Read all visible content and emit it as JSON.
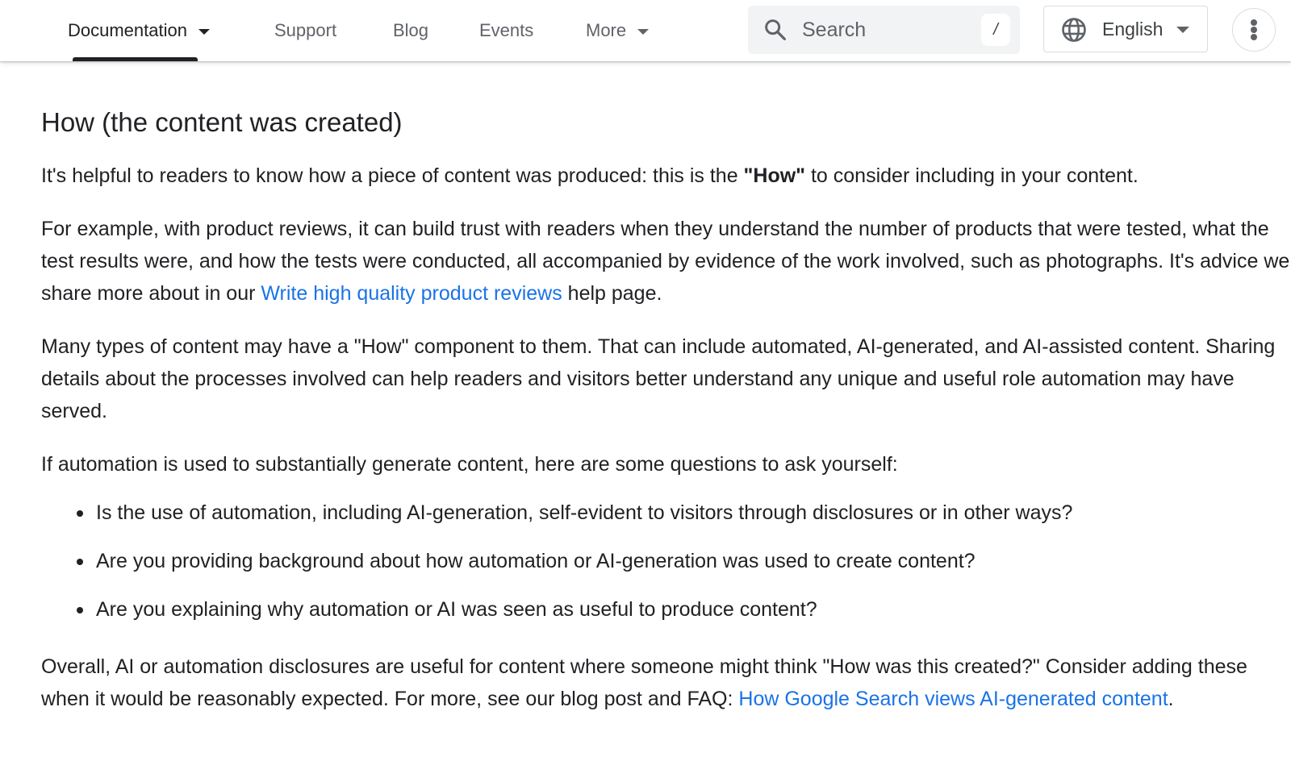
{
  "header": {
    "nav": [
      {
        "label": "Documentation",
        "has_dropdown": true,
        "active": true
      },
      {
        "label": "Support",
        "has_dropdown": false,
        "active": false
      },
      {
        "label": "Blog",
        "has_dropdown": false,
        "active": false
      },
      {
        "label": "Events",
        "has_dropdown": false,
        "active": false
      },
      {
        "label": "More",
        "has_dropdown": true,
        "active": false
      }
    ],
    "search": {
      "placeholder": "Search",
      "shortcut_key": "/",
      "icon": "search-icon"
    },
    "language": {
      "selected": "English",
      "icon": "globe-icon"
    },
    "overflow_menu_icon": "more-vert-icon"
  },
  "article": {
    "section_title": "How (the content was created)",
    "p1": {
      "before": "It's helpful to readers to know how a piece of content was produced: this is the ",
      "bold": "\"How\"",
      "after": " to consider including in your content."
    },
    "p2": {
      "before": "For example, with product reviews, it can build trust with readers when they understand the number of products that were tested, what the test results were, and how the tests were conducted, all accompanied by evidence of the work involved, such as photographs. It's advice we share more about in our ",
      "link": "Write high quality product reviews",
      "after": " help page."
    },
    "p3": "Many types of content may have a \"How\" component to them. That can include automated, AI-generated, and AI-assisted content. Sharing details about the processes involved can help readers and visitors better understand any unique and useful role automation may have served.",
    "p4": "If automation is used to substantially generate content, here are some questions to ask yourself:",
    "questions": [
      "Is the use of automation, including AI-generation, self-evident to visitors through disclosures or in other ways?",
      "Are you providing background about how automation or AI-generation was used to create content?",
      "Are you explaining why automation or AI was seen as useful to produce content?"
    ],
    "p5": {
      "before": "Overall, AI or automation disclosures are useful for content where someone might think \"How was this created?\" Consider adding these when it would be reasonably expected. For more, see our blog post and FAQ: ",
      "link": "How Google Search views AI-generated content",
      "after": "."
    }
  },
  "colors": {
    "text": "#202124",
    "muted_text": "#5f6368",
    "link": "#1a73e8",
    "search_bg": "#f1f3f4",
    "border": "#dadce0"
  }
}
